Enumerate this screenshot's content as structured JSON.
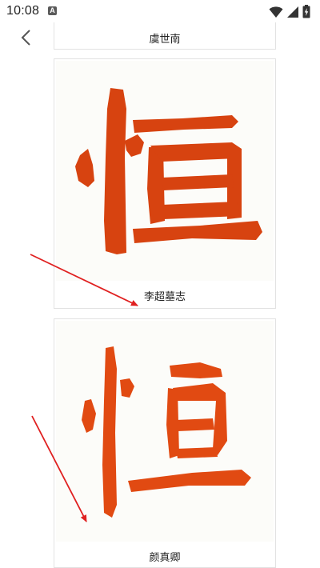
{
  "status_bar": {
    "time": "10:08",
    "notification_letter": "A"
  },
  "calligraphy_cards": [
    {
      "label": "虞世南"
    },
    {
      "label": "李超墓志",
      "glyph_color": "#d74310"
    },
    {
      "label": "颜真卿",
      "glyph_color": "#e14a12"
    }
  ],
  "colors": {
    "annotation_arrow": "#e02020",
    "card_border": "#e2e2e2"
  }
}
